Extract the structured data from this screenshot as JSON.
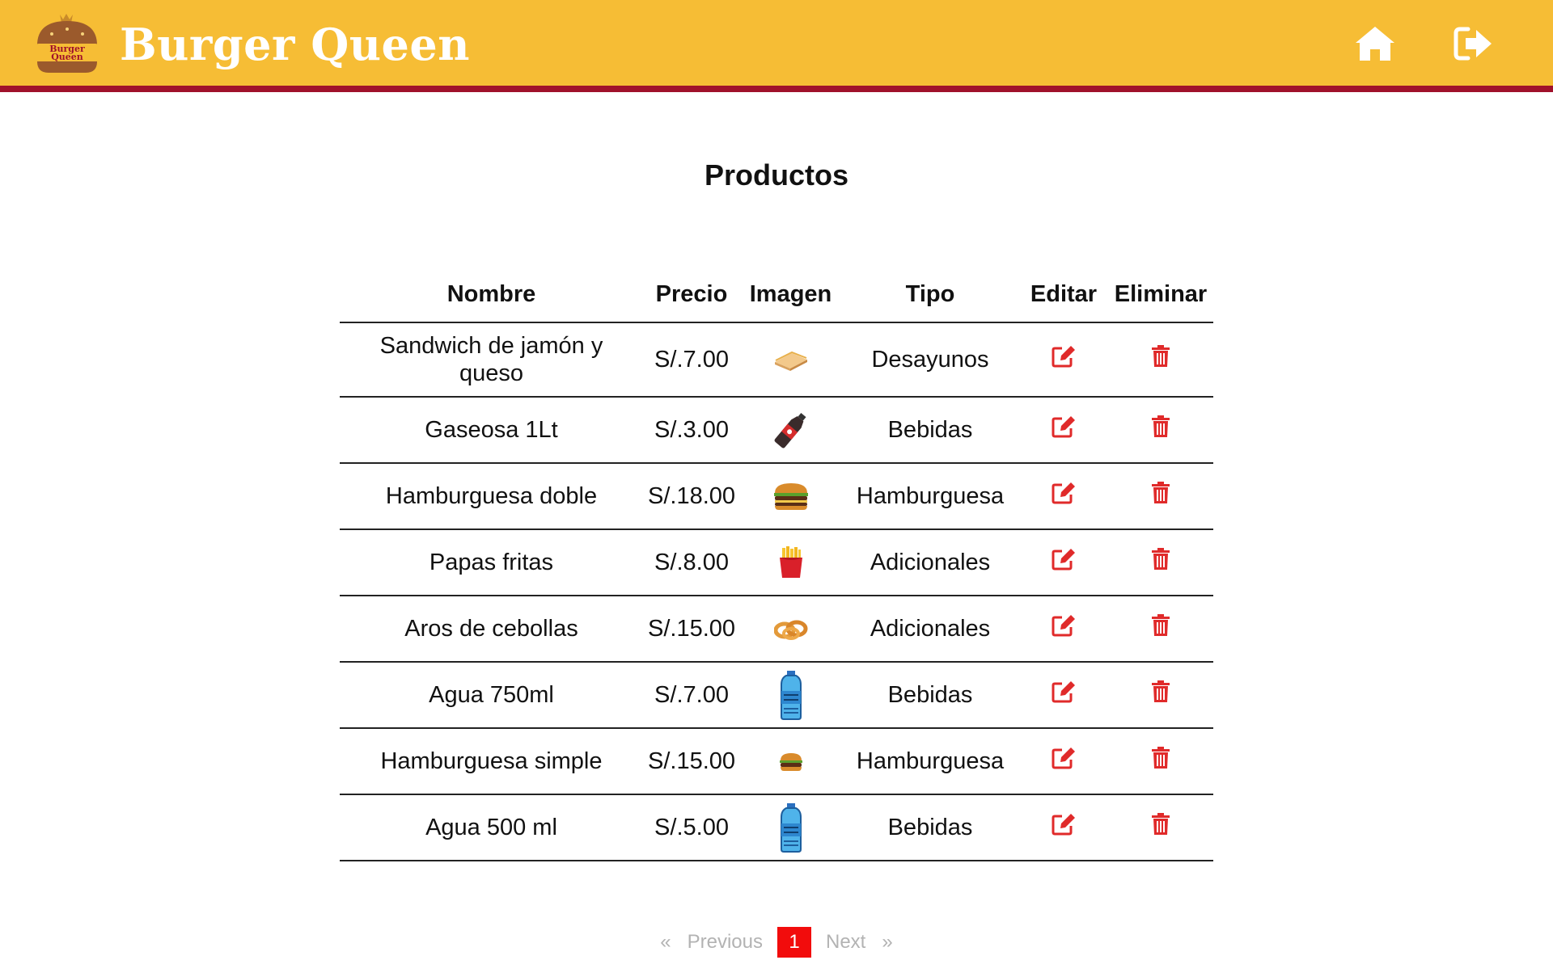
{
  "header": {
    "logo_text": "Burger Queen",
    "brand": "Burger Queen",
    "home_icon": "home-icon",
    "logout_icon": "sign-out-icon",
    "background": "#f6bd35",
    "border_color": "#a0112b"
  },
  "page": {
    "title": "Productos"
  },
  "table": {
    "columns": [
      "Nombre",
      "Precio",
      "Imagen",
      "Tipo",
      "Editar",
      "Eliminar"
    ],
    "rows": [
      {
        "name": "Sandwich de jamón y queso",
        "price": "S/.7.00",
        "image": "sandwich",
        "type": "Desayunos"
      },
      {
        "name": "Gaseosa 1Lt",
        "price": "S/.3.00",
        "image": "soda-bottle",
        "type": "Bebidas"
      },
      {
        "name": "Hamburguesa doble",
        "price": "S/.18.00",
        "image": "double-burger",
        "type": "Hamburguesa"
      },
      {
        "name": "Papas fritas",
        "price": "S/.8.00",
        "image": "french-fries",
        "type": "Adicionales"
      },
      {
        "name": "Aros de cebollas",
        "price": "S/.15.00",
        "image": "onion-rings",
        "type": "Adicionales"
      },
      {
        "name": "Agua 750ml",
        "price": "S/.7.00",
        "image": "water-bottle",
        "type": "Bebidas"
      },
      {
        "name": "Hamburguesa simple",
        "price": "S/.15.00",
        "image": "simple-burger",
        "type": "Hamburguesa"
      },
      {
        "name": "Agua 500 ml",
        "price": "S/.5.00",
        "image": "water-bottle",
        "type": "Bebidas"
      }
    ],
    "edit_icon": "edit-icon",
    "delete_icon": "trash-icon",
    "action_color": "#e02a2a"
  },
  "pagination": {
    "prev_arrow": "«",
    "prev_label": "Previous",
    "current_page": "1",
    "next_label": "Next",
    "next_arrow": "»",
    "active_color": "#f20c0c"
  }
}
